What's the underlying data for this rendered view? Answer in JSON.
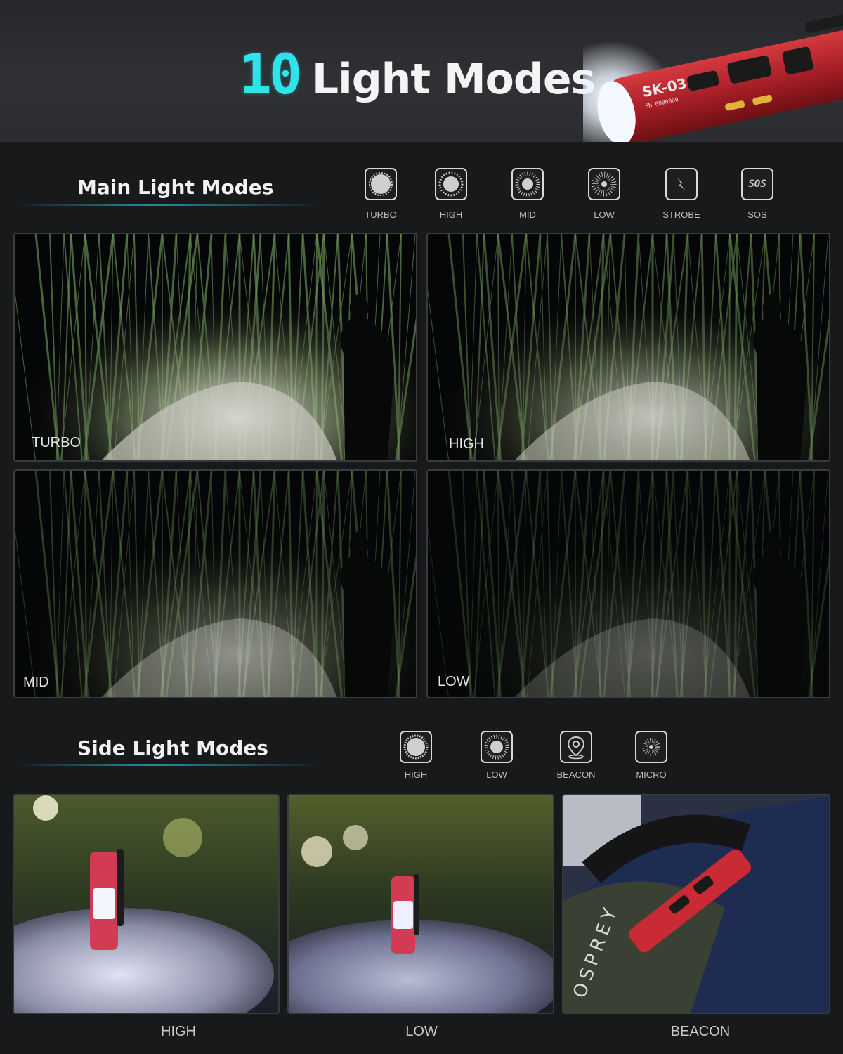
{
  "header": {
    "title_number": "10",
    "title_text": "Light Modes",
    "flashlight_engraving": "SK-03",
    "flashlight_serial": "SN 0000000"
  },
  "main_section": {
    "title": "Main Light Modes",
    "modes": [
      {
        "label": "TURBO",
        "icon": "sun-turbo-icon"
      },
      {
        "label": "HIGH",
        "icon": "sun-high-icon"
      },
      {
        "label": "MID",
        "icon": "sun-mid-icon"
      },
      {
        "label": "LOW",
        "icon": "sun-low-icon"
      },
      {
        "label": "STROBE",
        "icon": "lightning-icon"
      },
      {
        "label": "SOS",
        "icon": "sos-icon",
        "icon_text": "SOS"
      }
    ],
    "photos": [
      {
        "label": "TURBO",
        "brightness": 1.0
      },
      {
        "label": "HIGH",
        "brightness": 0.75
      },
      {
        "label": "MID",
        "brightness": 0.45
      },
      {
        "label": "LOW",
        "brightness": 0.2
      }
    ]
  },
  "side_section": {
    "title": "Side Light Modes",
    "modes": [
      {
        "label": "HIGH",
        "icon": "sun-high-icon"
      },
      {
        "label": "LOW",
        "icon": "sun-low-icon"
      },
      {
        "label": "BEACON",
        "icon": "location-pin-icon"
      },
      {
        "label": "MICRO",
        "icon": "sun-micro-icon"
      }
    ],
    "photos": [
      {
        "label": "HIGH"
      },
      {
        "label": "LOW"
      },
      {
        "label": "BEACON",
        "bag_text": "OSPREY"
      }
    ]
  },
  "colors": {
    "accent_cyan": "#2fe3ea",
    "flashlight_red": "#b3222a",
    "background": "#18191b"
  }
}
